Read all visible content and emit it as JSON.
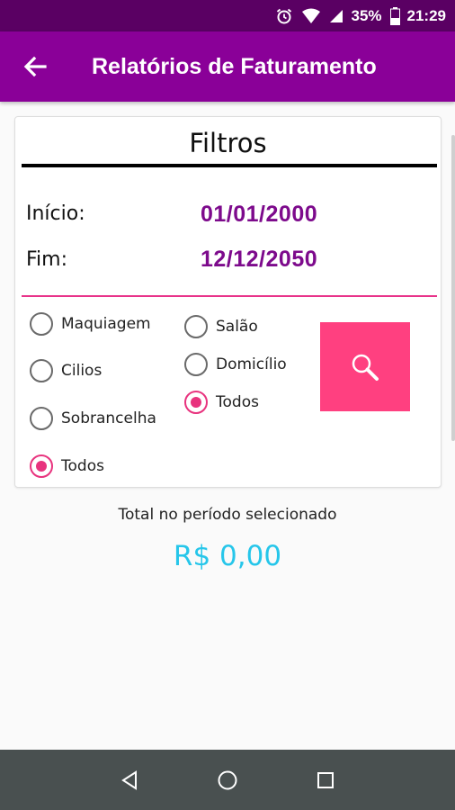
{
  "status_bar": {
    "battery_percent": "35%",
    "time": "21:29"
  },
  "app_bar": {
    "title": "Relatórios de Faturamento"
  },
  "filters": {
    "title": "Filtros",
    "start_label": "Início:",
    "start_value": "01/01/2000",
    "end_label": "Fim:",
    "end_value": "12/12/2050",
    "service_options": [
      {
        "label": "Maquiagem",
        "checked": false
      },
      {
        "label": "Cilios",
        "checked": false
      },
      {
        "label": "Sobrancelha",
        "checked": false
      },
      {
        "label": "Todos",
        "checked": true
      }
    ],
    "location_options": [
      {
        "label": "Salão",
        "checked": false
      },
      {
        "label": "Domicílio",
        "checked": false
      },
      {
        "label": "Todos",
        "checked": true
      }
    ]
  },
  "summary": {
    "label": "Total no período selecionado",
    "value": "R$ 0,00"
  },
  "colors": {
    "status_bar": "#5a0063",
    "app_bar": "#8a0098",
    "date_value": "#7d0a8c",
    "accent_pink": "#ff4080",
    "total_value": "#26c6ea",
    "nav_bar": "#495050"
  }
}
